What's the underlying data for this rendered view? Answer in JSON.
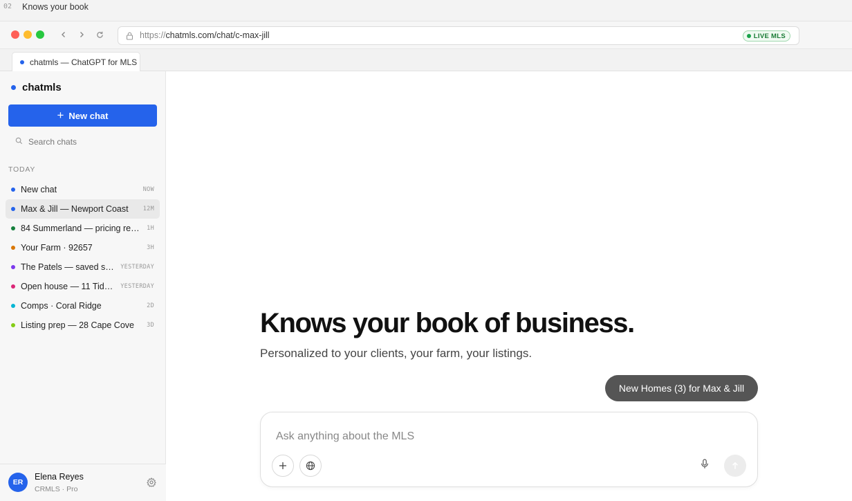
{
  "window": {
    "index": "02",
    "title": "Knows your book"
  },
  "browser": {
    "url_proto": "https://",
    "url_rest": "chatmls.com/chat/c-max-jill",
    "status_badge": "LIVE MLS",
    "tab_title": "chatmls — ChatGPT for MLS",
    "colors": {
      "accent": "#2563eb",
      "live": "#19a34a"
    }
  },
  "sidebar": {
    "brand": "chatmls",
    "new_chat_label": "New chat",
    "search_placeholder": "Search chats",
    "section_label": "TODAY",
    "chats": [
      {
        "title": "New chat",
        "time": "NOW",
        "color": "#2563eb"
      },
      {
        "title": "Max & Jill — Newport Coast",
        "time": "12M",
        "color": "#2563eb",
        "active": true
      },
      {
        "title": "84 Summerland — pricing rec...",
        "time": "1H",
        "color": "#15803d"
      },
      {
        "title": "Your Farm · 92657",
        "time": "3H",
        "color": "#d97706"
      },
      {
        "title": "The Patels — saved se...",
        "time": "YESTERDAY",
        "color": "#7c3aed"
      },
      {
        "title": "Open house — 11 Tide ...",
        "time": "YESTERDAY",
        "color": "#db2777"
      },
      {
        "title": "Comps · Coral Ridge",
        "time": "2D",
        "color": "#06b6d4"
      },
      {
        "title": "Listing prep — 28 Cape Cove",
        "time": "3D",
        "color": "#84cc16"
      }
    ],
    "user": {
      "initials": "ER",
      "name": "Elena Reyes",
      "plan": "CRMLS · Pro"
    }
  },
  "main": {
    "headline": "Knows your book of business.",
    "subhead": "Personalized to your clients, your farm, your listings.",
    "suggestion": "New Homes (3) for Max & Jill",
    "composer_placeholder": "Ask anything about the MLS"
  }
}
